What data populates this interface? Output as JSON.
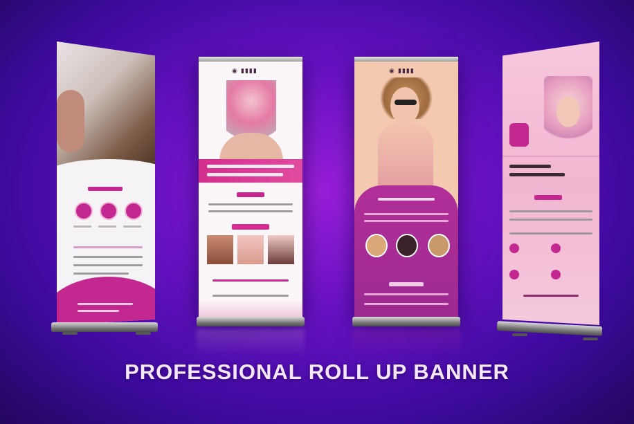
{
  "title": "PROFESSIONAL ROLL UP BANNER",
  "colors": {
    "background": "#5a10c0",
    "accent_magenta": "#c2288f",
    "accent_pink": "#e55fa8",
    "light_pink": "#f6d8e6",
    "peach": "#f3c9b0"
  },
  "banners": [
    {
      "name": "banner-1",
      "style": "white top photo, magenta curved footer, three circular icons"
    },
    {
      "name": "banner-2",
      "style": "white with floral portrait, magenta headline band, three photos"
    },
    {
      "name": "banner-3",
      "style": "peach portrait top, purple lower panel with three round photos"
    },
    {
      "name": "banner-4",
      "style": "pink with portrait top right, icon list"
    }
  ]
}
